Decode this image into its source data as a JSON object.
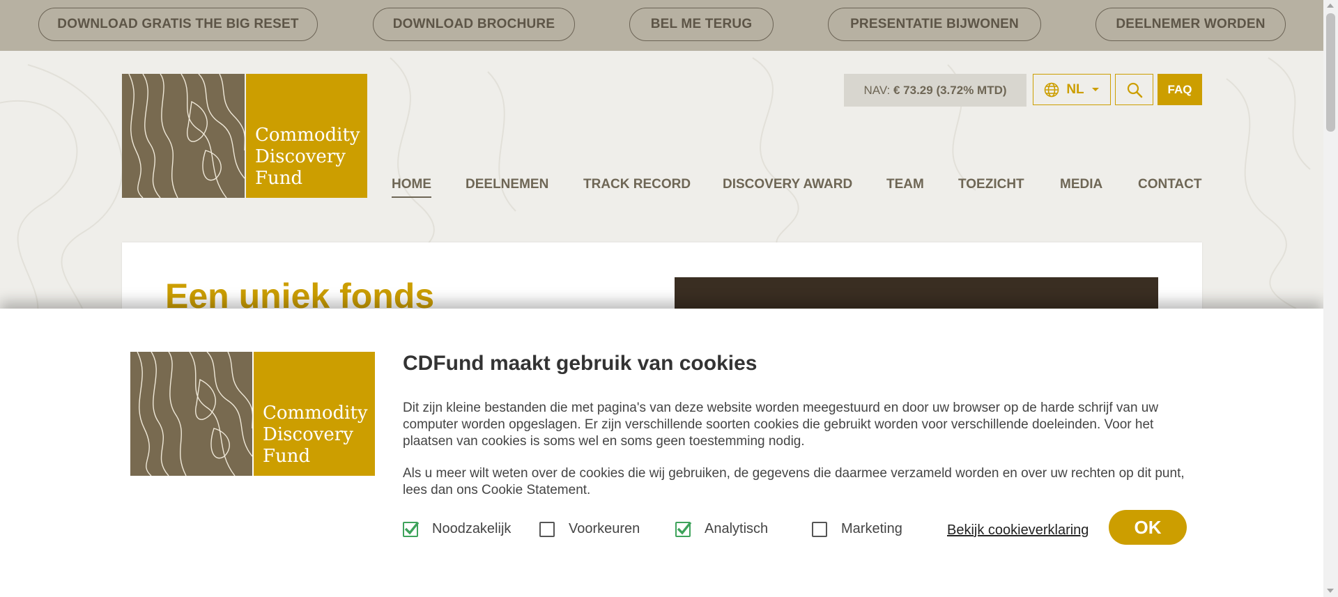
{
  "topbar": {
    "buttons": [
      {
        "label": "DOWNLOAD GRATIS THE BIG RESET"
      },
      {
        "label": "DOWNLOAD BROCHURE"
      },
      {
        "label": "BEL ME TERUG"
      },
      {
        "label": "PRESENTATIE BIJWONEN"
      },
      {
        "label": "DEELNEMER WORDEN"
      }
    ]
  },
  "logo": {
    "line1": "Commodity",
    "line2": "Discovery",
    "line3": "Fund"
  },
  "header": {
    "nav_label": "NAV:",
    "nav_value": "€ 73.29 (3.72% MTD)",
    "language": "NL",
    "faq": "FAQ"
  },
  "menu": {
    "items": [
      {
        "label": "HOME"
      },
      {
        "label": "DEELNEMEN"
      },
      {
        "label": "TRACK RECORD"
      },
      {
        "label": "DISCOVERY AWARD"
      },
      {
        "label": "TEAM"
      },
      {
        "label": "TOEZICHT"
      },
      {
        "label": "MEDIA"
      },
      {
        "label": "CONTACT"
      }
    ],
    "active": "HOME"
  },
  "content": {
    "heading": "Een uniek fonds"
  },
  "cookie": {
    "title": "CDFund maakt gebruik van cookies",
    "paragraph1": "Dit zijn kleine bestanden die met pagina's van deze website worden meegestuurd en door uw browser op de harde schrijf van uw computer worden opgeslagen. Er zijn verschillende soorten cookies die gebruikt worden voor verschillende doeleinden. Voor het plaatsen van cookies is soms wel en soms geen toestemming nodig.",
    "paragraph2": "Als u meer wilt weten over de cookies die wij gebruiken, de gegevens die daarmee verzameld worden en over uw rechten op dit punt, lees dan ons Cookie Statement.",
    "options": [
      {
        "label": "Noodzakelijk",
        "checked": true
      },
      {
        "label": "Voorkeuren",
        "checked": false
      },
      {
        "label": "Analytisch",
        "checked": true
      },
      {
        "label": "Marketing",
        "checked": false
      }
    ],
    "link": "Bekijk cookieverklaring",
    "ok": "OK"
  },
  "colors": {
    "gold": "#cc9e00",
    "brown": "#786a50",
    "topbar": "#b7b1a2",
    "check": "#3ea35b"
  }
}
